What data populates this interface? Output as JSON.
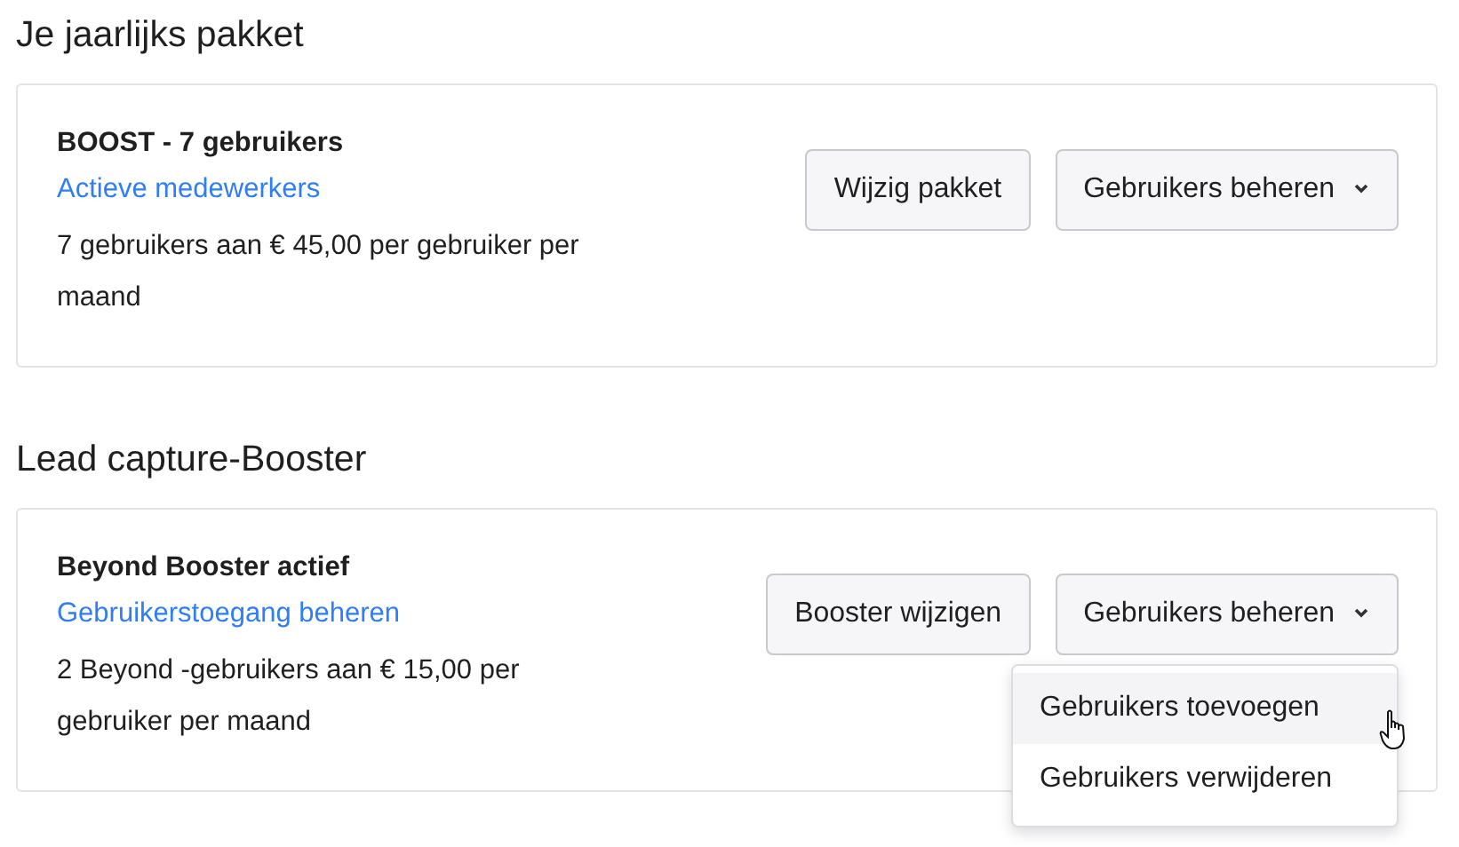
{
  "sections": [
    {
      "heading": "Je jaarlijks pakket",
      "card": {
        "title": "BOOST - 7 gebruikers",
        "link": "Actieve medewerkers",
        "description": "7 gebruikers aan € 45,00 per gebruiker per maand",
        "buttons": [
          {
            "label": "Wijzig pakket",
            "kind": "plain"
          },
          {
            "label": "Gebruikers beheren",
            "kind": "dropdown"
          }
        ]
      }
    },
    {
      "heading": "Lead capture-Booster",
      "card": {
        "title": "**Beyond** Booster actief",
        "link": "Gebruikerstoegang beheren",
        "description": "2 Beyond -gebruikers aan € 15,00 per gebruiker per maand",
        "buttons": [
          {
            "label": "Booster wijzigen",
            "kind": "plain"
          },
          {
            "label": "Gebruikers beheren",
            "kind": "dropdown",
            "menu": [
              {
                "label": "Gebruikers toevoegen",
                "hovered": true
              },
              {
                "label": "Gebruikers verwijderen",
                "hovered": false
              }
            ]
          }
        ]
      }
    }
  ]
}
